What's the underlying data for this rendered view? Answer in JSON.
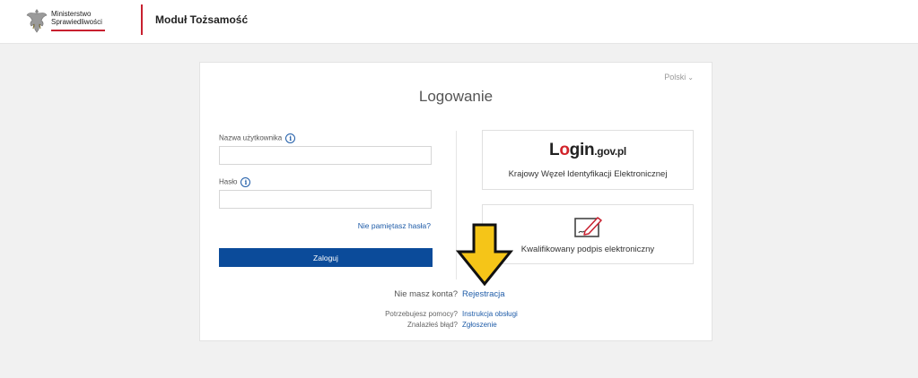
{
  "header": {
    "ministry_line1": "Ministerstwo",
    "ministry_line2": "Sprawiedliwości",
    "module_title": "Moduł Tożsamość",
    "accent_color": "#c8202f"
  },
  "card": {
    "language": "Polski",
    "title": "Logowanie",
    "username_label": "Nazwa użytkownika",
    "username_value": "",
    "password_label": "Hasło",
    "password_value": "",
    "forgot_link": "Nie pamiętasz hasła?",
    "login_button": "Zaloguj",
    "login_button_color": "#0b4b9a",
    "options": {
      "login_gov": {
        "logo_text": "gin",
        "logo_domain": ".gov.pl",
        "logo_prefix": "L",
        "caption": "Krajowy Węzeł Identyfikacji Elektronicznej"
      },
      "qualified_signature": {
        "icon": "signature-icon",
        "caption": "Kwalifikowany podpis elektroniczny"
      }
    },
    "no_account_question": "Nie masz konta?",
    "register_link": "Rejestracja",
    "help_question": "Potrzebujesz pomocy?",
    "help_link": "Instrukcja obsługi",
    "bug_question": "Znalazłeś błąd?",
    "bug_link": "Zgłoszenie"
  },
  "annotation": {
    "arrow_color": "#f5c518",
    "icon": "arrow-down-icon"
  }
}
